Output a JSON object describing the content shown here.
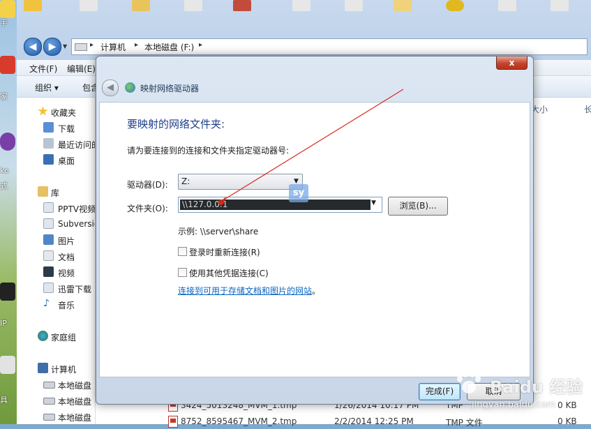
{
  "desktop": {
    "labels": [
      "手",
      "家",
      "ke",
      "式",
      "IP",
      "具"
    ]
  },
  "explorer": {
    "address": {
      "crumbs": [
        "计算机",
        "本地磁盘 (F:)"
      ]
    },
    "menu": [
      "文件(F)",
      "编辑(E)"
    ],
    "toolbar": [
      "组织 ▾",
      "包含"
    ],
    "nav": {
      "favorites": "收藏夹",
      "fav_items": [
        "下载",
        "最近访问的",
        "桌面"
      ],
      "library": "库",
      "lib_items": [
        "PPTV视频",
        "Subversion",
        "图片",
        "文档",
        "视频",
        "迅雷下载",
        "音乐"
      ],
      "homegroup": "家庭组",
      "computer": "计算机",
      "drives": [
        "本地磁盘",
        "本地磁盘 (",
        "本地磁盘 (E:)"
      ]
    },
    "columns": {
      "size": "大小",
      "length": "长"
    },
    "files": [
      {
        "name": "3424_5013248_MVM_1.tmp",
        "date": "1/26/2014 10:17 PM",
        "type": "TMP",
        "size": "0 KB"
      },
      {
        "name": "8752_8595467_MVM_2.tmp",
        "date": "2/2/2014 12:25 PM",
        "type": "TMP 文件",
        "size": "0 KB"
      }
    ]
  },
  "dialog": {
    "title": "映射网络驱动器",
    "close": "x",
    "heading": "要映射的网络文件夹:",
    "instruction": "请为要连接到的连接和文件夹指定驱动器号:",
    "drive_label": "驱动器(D):",
    "drive_value": "Z:",
    "folder_label": "文件夹(O):",
    "folder_value": "\\\\127.0.0.1",
    "browse": "浏览(B)...",
    "example": "示例: \\\\server\\share",
    "reconnect": "登录时重新连接(R)",
    "other_creds": "使用其他凭据连接(C)",
    "link": "连接到可用于存储文档和图片的网站",
    "link_tail": "。",
    "finish": "完成(F)",
    "cancel": "取消"
  },
  "overlay": {
    "badge": "sy"
  },
  "watermark": {
    "brand": "Baidu 经验",
    "url": "jingyan.baidu.com"
  }
}
